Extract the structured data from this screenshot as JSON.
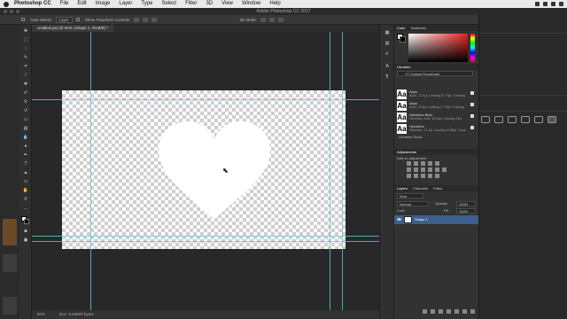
{
  "menubar": {
    "app_name": "Photoshop CC",
    "items": [
      "File",
      "Edit",
      "Image",
      "Layer",
      "Type",
      "Select",
      "Filter",
      "3D",
      "View",
      "Window",
      "Help"
    ]
  },
  "window": {
    "title": "Adobe Photoshop CC 2017"
  },
  "options_bar": {
    "auto_select_label": "Auto-Select:",
    "auto_select_value": "Layer",
    "show_transform_label": "Show Transform Controls",
    "mode_3d_label": "3D Mode:"
  },
  "document": {
    "tab_title": "Untitled.psd @ 50% (Shape 1, RGB/8) *",
    "zoom": "50%",
    "doc_size": "Doc: 5.93M/0 bytes"
  },
  "panels": {
    "color_tab": "Color",
    "swatches_tab": "Swatches",
    "libraries_tab": "Libraries",
    "library_selected": "YT-CustomThumbnail",
    "library_items": [
      {
        "thumb": "Aa",
        "name": "Abys",
        "desc": "Abys, 72.5 pt, Leading 67.75pt, Tracking"
      },
      {
        "thumb": "Aa",
        "name": "Abys",
        "desc": "Abys, 29.5pt, Leading 17.75pt, Tracking"
      },
      {
        "thumb": "Aa",
        "name": "Helvetica Bold",
        "desc": "Helvetica, Bold, 18.54pt, Leading 23pt"
      },
      {
        "thumb": "Aa",
        "name": "Helvetica",
        "desc": "Helvetica, 17.1pt, Leading 19.86pt, Track"
      }
    ],
    "library_footer": "Libraries Stock",
    "adjustments_tab": "Adjustments",
    "add_adjustment": "Add an adjustment",
    "layers_tabs": [
      "Layers",
      "Channels",
      "Paths"
    ],
    "kind_filter": "Kind",
    "blend_mode": "Normal",
    "opacity_label": "Opacity:",
    "opacity_value": "100%",
    "lock_label": "Lock:",
    "fill_label": "Fill:",
    "fill_value": "100%",
    "layer_name": "Shape 1"
  },
  "colors": {
    "guide": "#5fc8d8",
    "selected_layer": "#3d5f8a",
    "foreground": "#ffffff",
    "background": "#000000"
  }
}
